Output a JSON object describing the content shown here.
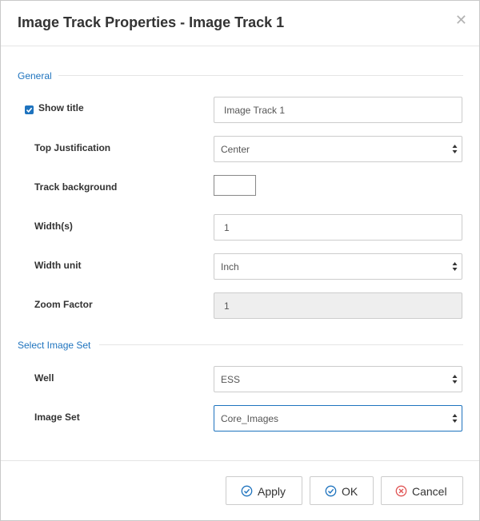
{
  "dialog": {
    "title": "Image Track Properties - Image Track 1",
    "close_icon": "close-icon"
  },
  "general": {
    "section_label": "General",
    "show_title": {
      "label": "Show title",
      "checked": true,
      "value": "Image Track 1"
    },
    "top_justification": {
      "label": "Top Justification",
      "value": "Center"
    },
    "track_background": {
      "label": "Track background",
      "color": "#ffffff"
    },
    "width": {
      "label": "Width(s)",
      "value": "1"
    },
    "width_unit": {
      "label": "Width unit",
      "value": "Inch"
    },
    "zoom_factor": {
      "label": "Zoom Factor",
      "value": "1"
    }
  },
  "image_set_section": {
    "section_label": "Select Image Set",
    "well": {
      "label": "Well",
      "value": "ESS"
    },
    "image_set": {
      "label": "Image Set",
      "value": "Core_Images"
    }
  },
  "buttons": {
    "apply": "Apply",
    "ok": "OK",
    "cancel": "Cancel"
  },
  "colors": {
    "accent": "#1e73be",
    "cancel_icon": "#e05555",
    "ok_icon": "#1e73be"
  }
}
